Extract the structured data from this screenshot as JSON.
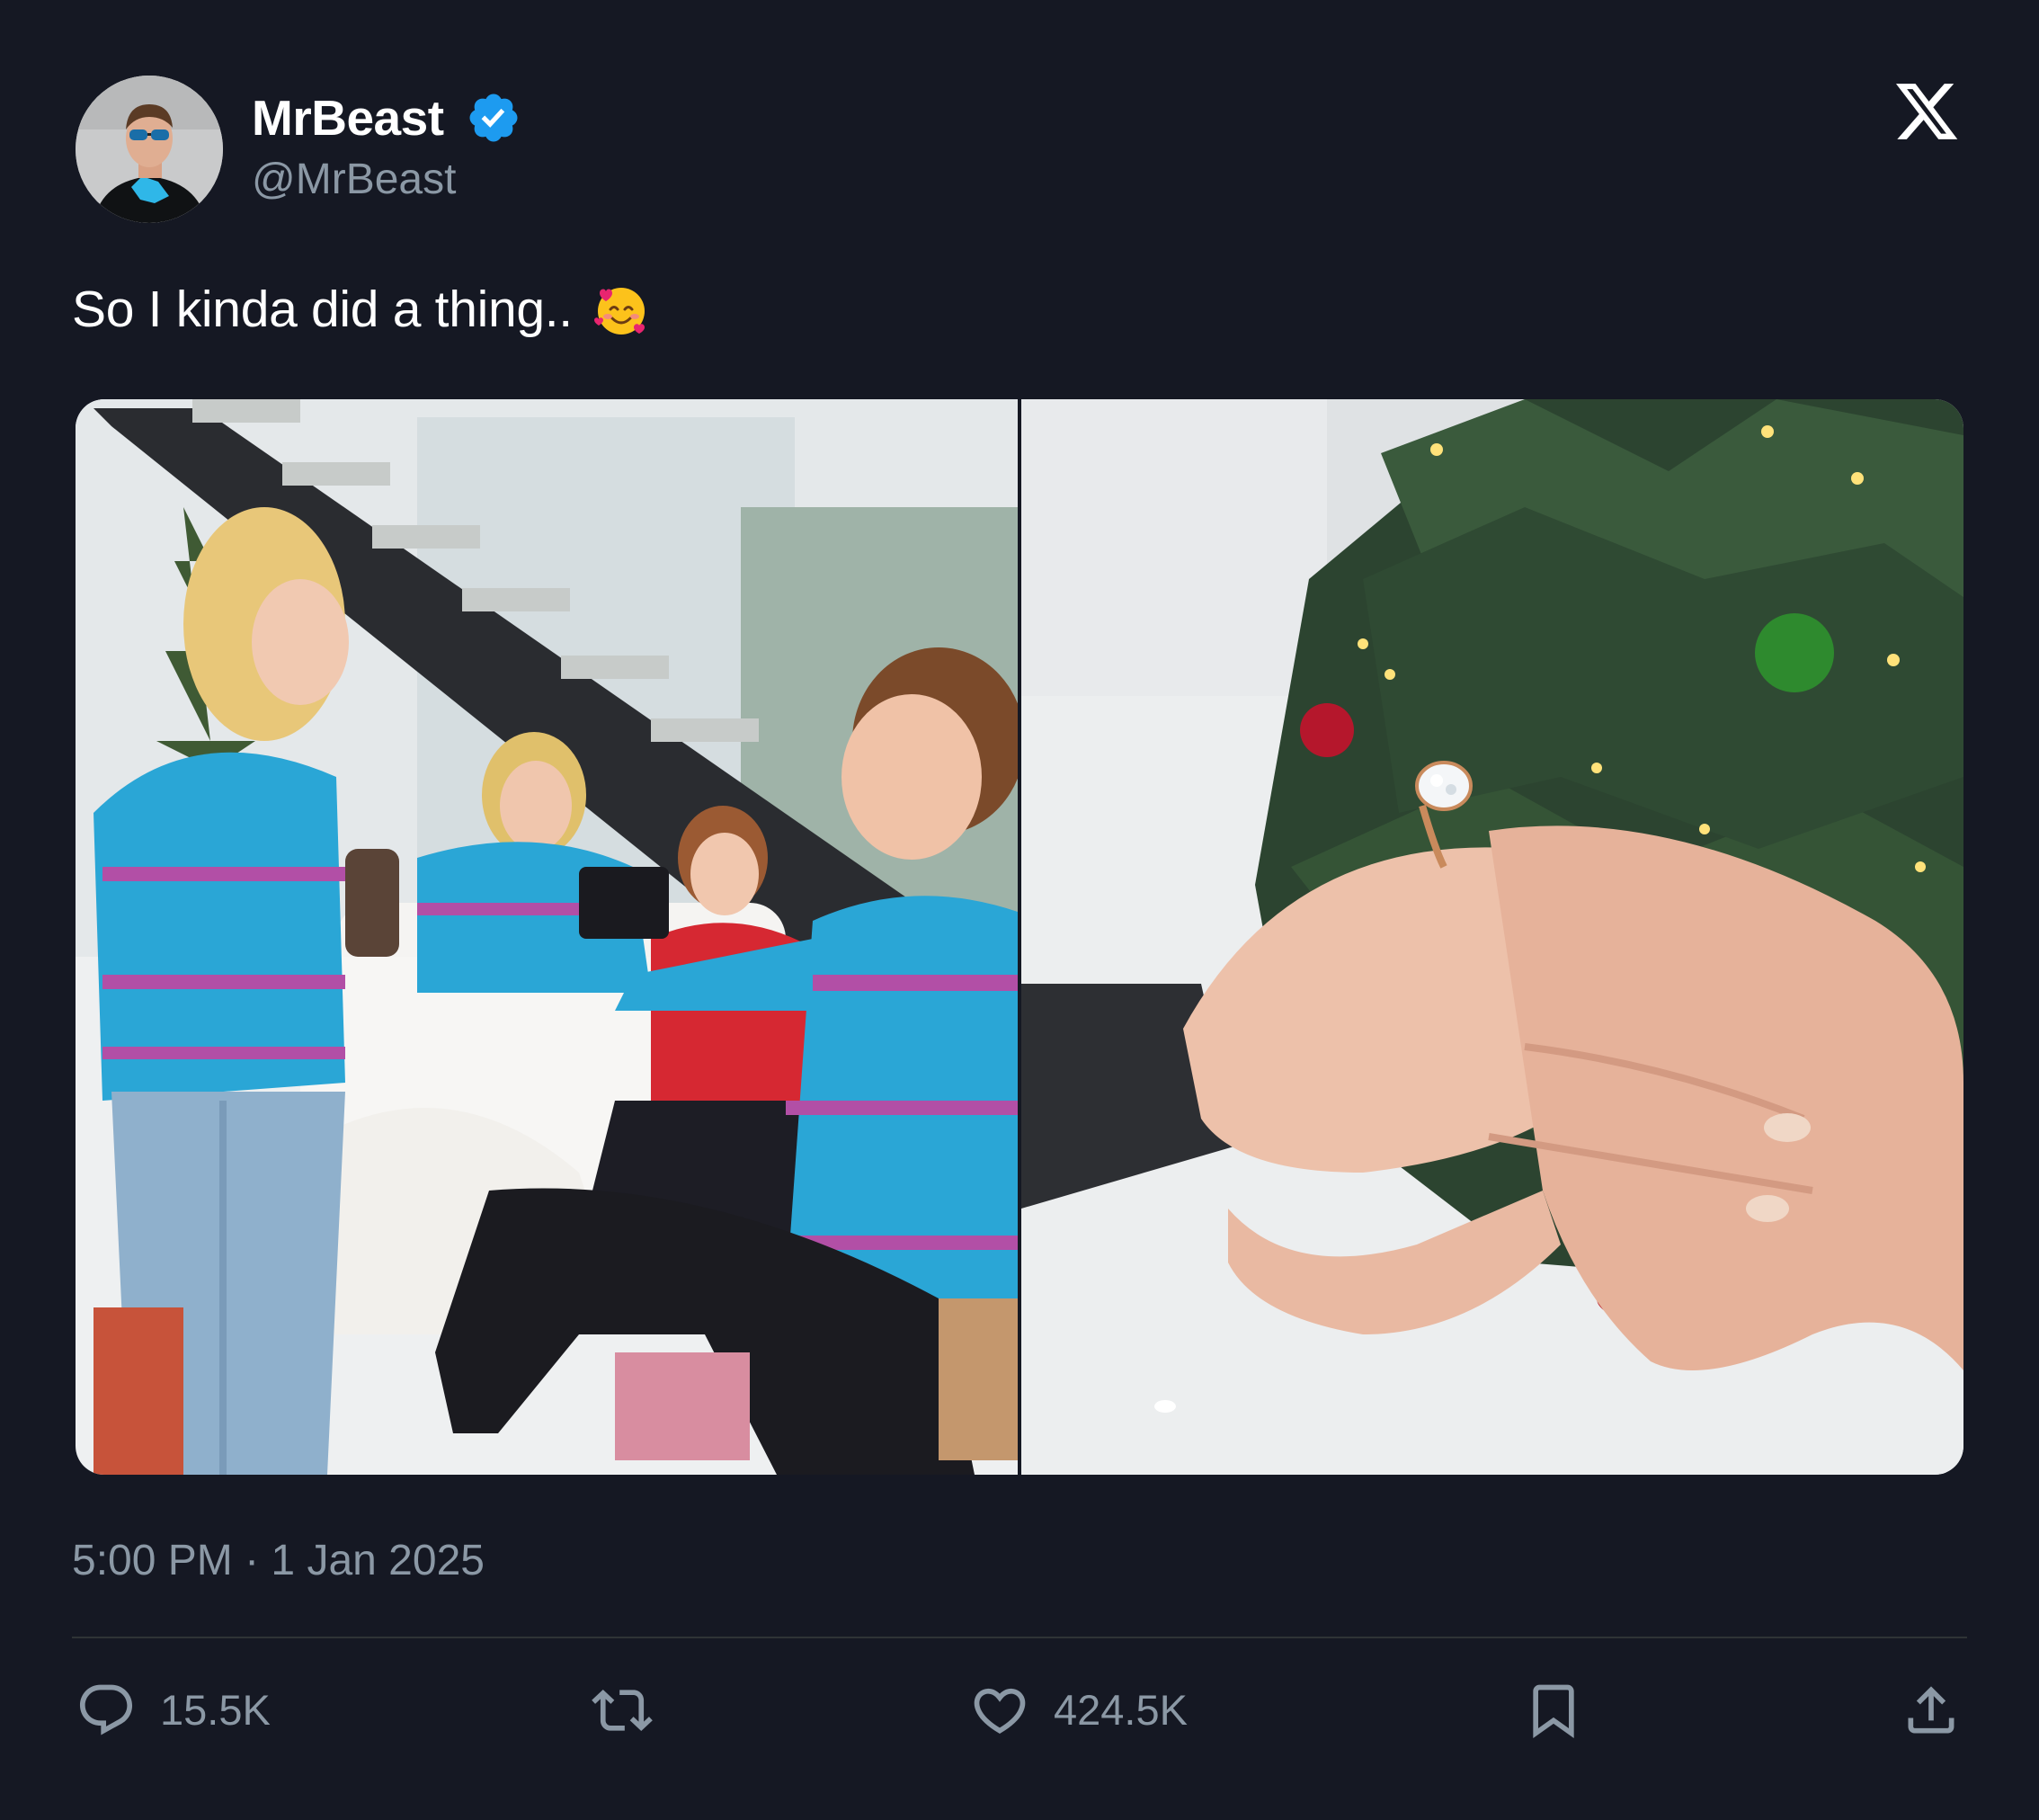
{
  "author": {
    "display_name": "MrBeast",
    "handle": "@MrBeast",
    "verified": true
  },
  "tweet": {
    "text": "So I kinda did a thing..",
    "emoji": "smiling-face-with-hearts"
  },
  "meta": {
    "timestamp": "5:00 PM · 1 Jan 2025"
  },
  "actions": {
    "replies": "15.5K",
    "likes": "424.5K"
  },
  "icons": {
    "reply": "reply-icon",
    "repost": "repost-icon",
    "like": "heart-icon",
    "bookmark": "bookmark-icon",
    "share": "share-icon",
    "brand": "x-logo-icon"
  },
  "colors": {
    "background": "#151823",
    "text": "#ffffff",
    "secondary": "#8b98a5",
    "verified": "#1d9bf0",
    "divider": "#2f3336"
  }
}
